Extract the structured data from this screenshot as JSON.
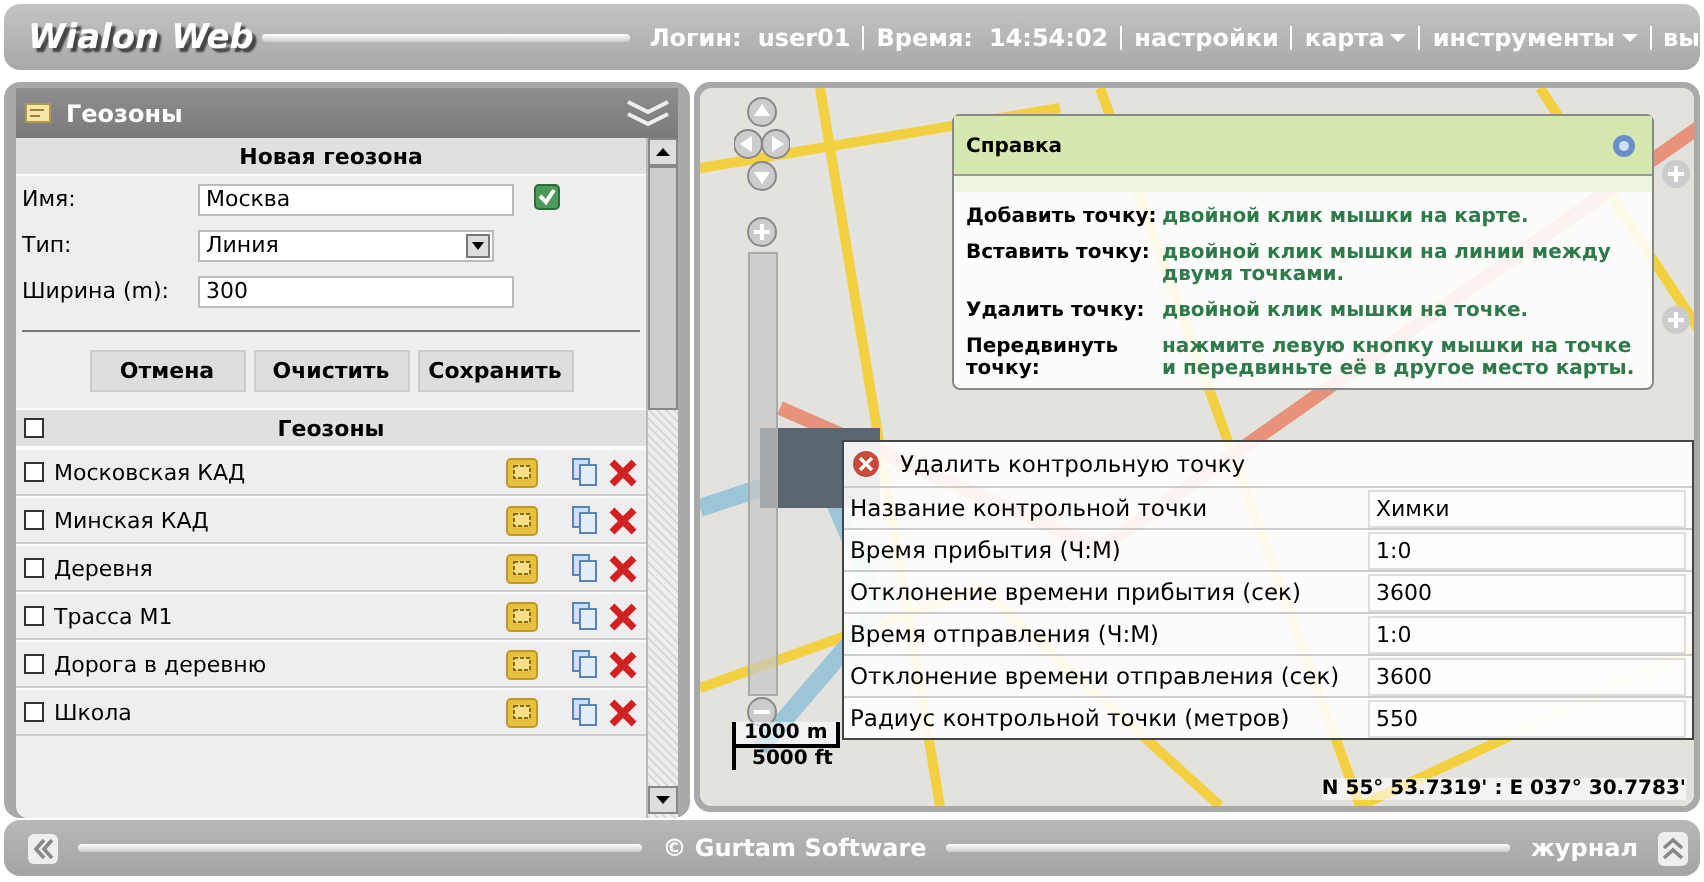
{
  "header": {
    "logo": "Wialon Web",
    "login_label": "Логин:",
    "login_value": "user01",
    "time_label": "Время:",
    "time_value": "14:54:02",
    "menu": [
      {
        "label": "настройки",
        "dropdown": false
      },
      {
        "label": "карта",
        "dropdown": true
      },
      {
        "label": "инструменты",
        "dropdown": true
      },
      {
        "label": "вы",
        "dropdown": false
      }
    ]
  },
  "geozones_panel": {
    "title": "Геозоны",
    "form": {
      "title": "Новая геозона",
      "fields": [
        {
          "kind": "text",
          "label": "Имя:",
          "value": "Москва",
          "checked": true
        },
        {
          "kind": "select",
          "label": "Тип:",
          "value": "Линия"
        },
        {
          "kind": "text",
          "label": "Ширина (m):",
          "value": "300"
        }
      ],
      "buttons": [
        "Отмена",
        "Очистить",
        "Сохранить"
      ]
    },
    "list": {
      "title": "Геозоны",
      "all_checked": false,
      "items": [
        {
          "name": "Московская КАД",
          "checked": false
        },
        {
          "name": "Минская КАД",
          "checked": false
        },
        {
          "name": "Деревня",
          "checked": false
        },
        {
          "name": "Трасса М1",
          "checked": false
        },
        {
          "name": "Дорога в деревню",
          "checked": false
        },
        {
          "name": "Школа",
          "checked": false
        }
      ]
    }
  },
  "map": {
    "help": {
      "title": "Справка",
      "rows": [
        {
          "term": "Добавить точку:",
          "text": "двойной клик мышки на карте."
        },
        {
          "term": "Вставить точку:",
          "text": "двойной клик мышки на линии между двумя точками."
        },
        {
          "term": "Удалить точку:",
          "text": "двойной клик мышки на точке."
        },
        {
          "term": "Передвинуть точку:",
          "text": "нажмите левую кнопку мышки на точке и передвиньте её в другое место карты."
        }
      ]
    },
    "checkpoint": {
      "title": "Удалить контрольную точку",
      "rows": [
        {
          "label": "Название контрольной точки",
          "value": "Химки"
        },
        {
          "label": "Время прибытия (Ч:М)",
          "value": "1:0"
        },
        {
          "label": "Отклонение времени прибытия (сек)",
          "value": "3600"
        },
        {
          "label": "Время отправления (Ч:М)",
          "value": "1:0"
        },
        {
          "label": "Отклонение времени отправления (сек)",
          "value": "3600"
        },
        {
          "label": "Радиус контрольной точки (метров)",
          "value": "550"
        }
      ]
    },
    "scale": {
      "metric": "1000 m",
      "imperial": "5000 ft"
    },
    "coordinates": "N 55° 53.7319' : E 037° 30.7783'"
  },
  "footer": {
    "copyright": "© Gurtam Software",
    "journal": "журнал"
  }
}
